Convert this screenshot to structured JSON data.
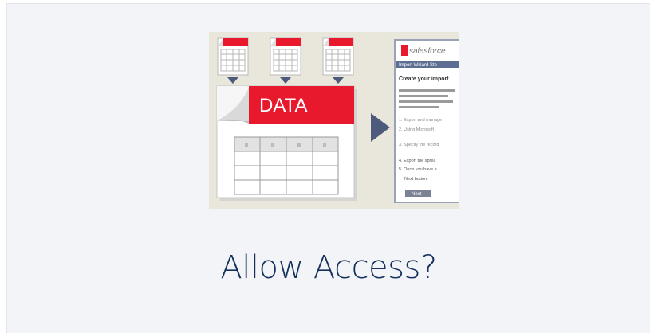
{
  "dialog": {
    "title": "Allow Access?"
  },
  "illustration": {
    "data_label": "DATA",
    "table_header_glyph": "ıı",
    "app_logo": "salesforce",
    "wizard_header": "Import Wizard Ste",
    "wizard_heading": "Create your import",
    "steps": [
      "1. Export and manage",
      "2. Using Microsoft",
      "3. Specify the record",
      "4. Export the sprea",
      "5. Once you have a"
    ],
    "step5_cont": "Next button.",
    "next_button": "Next",
    "colors": {
      "accent_red": "#e8192c",
      "arrow": "#4e5a7c",
      "title": "#16325c",
      "panel_bg": "#f3f4f7"
    }
  }
}
